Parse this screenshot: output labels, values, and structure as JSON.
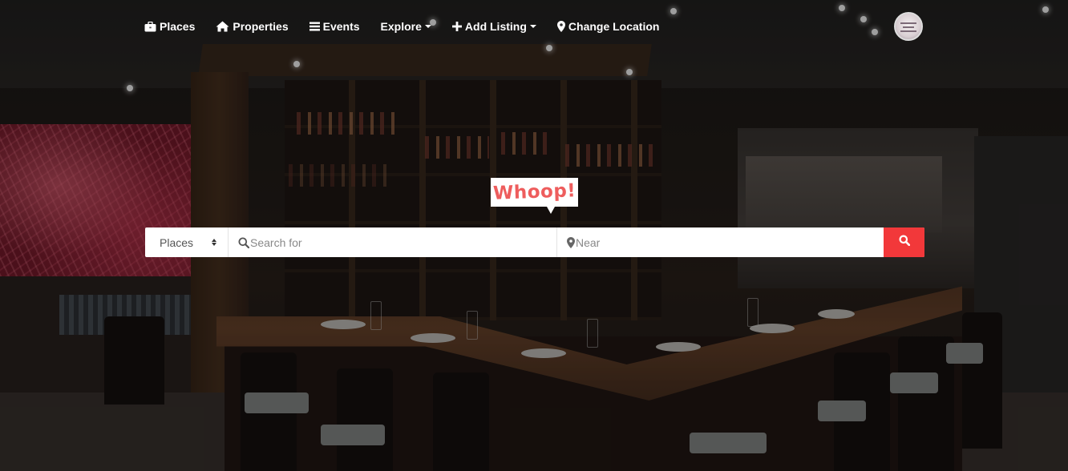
{
  "nav": {
    "items": [
      {
        "label": "Places",
        "icon": "briefcase-icon"
      },
      {
        "label": "Properties",
        "icon": "home-icon"
      },
      {
        "label": "Events",
        "icon": "list-icon"
      },
      {
        "label": "Explore",
        "icon": "",
        "dropdown": true
      },
      {
        "label": "Add Listing",
        "icon": "plus-icon",
        "dropdown": true
      },
      {
        "label": "Change Location",
        "icon": "map-marker-icon"
      }
    ],
    "avatar_icon": "user-avatar"
  },
  "logo": {
    "text": "Whoop!",
    "color": "#ee5d5d"
  },
  "search": {
    "type_selected": "Places",
    "search_placeholder": "Search for",
    "near_placeholder": "Near",
    "button_icon": "search-icon",
    "button_color": "#f2383a"
  }
}
